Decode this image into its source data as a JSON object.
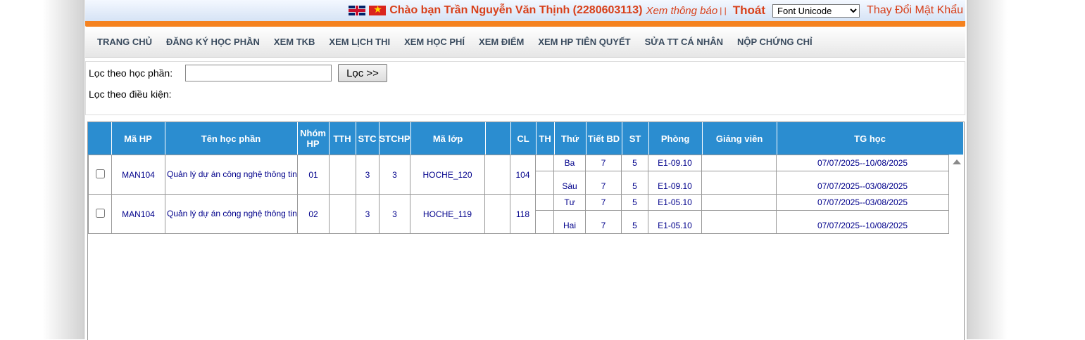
{
  "topbar": {
    "greeting": "Chào bạn Trần Nguyễn Văn Thịnh (2280603113)",
    "notice_link": "Xem thông báo",
    "separator": "| |",
    "logout": "Thoát",
    "font_select_value": "Font Unicode",
    "change_password": "Thay Đổi Mật Khẩu"
  },
  "menu": {
    "items": [
      "TRANG CHỦ",
      "ĐĂNG KÝ HỌC PHẦN",
      "XEM TKB",
      "XEM LỊCH THI",
      "XEM HỌC PHÍ",
      "XEM ĐIỂM",
      "XEM HP TIÊN QUYẾT",
      "SỬA TT CÁ NHÂN",
      "NỘP CHỨNG CHỈ"
    ]
  },
  "filter": {
    "course_label": "Lọc theo học phần:",
    "course_value": "",
    "filter_button": "Lọc >>",
    "condition_label": "Lọc theo điều kiện:"
  },
  "table": {
    "headers": [
      "",
      "Mã HP",
      "Tên học phần",
      "Nhóm HP",
      "TTH",
      "STC",
      "STCHP",
      "Mã lớp",
      "",
      "CL",
      "TH",
      "Thứ",
      "Tiết BD",
      "ST",
      "Phòng",
      "Giảng viên",
      "TG học"
    ],
    "rows": [
      {
        "code": "MAN104",
        "name": "Quản lý dự án công nghệ thông tin",
        "group": "01",
        "tth": "",
        "stc": "3",
        "stchp": "3",
        "class_code": "HOCHE_120",
        "blank": "",
        "cl": "104",
        "th": "",
        "sessions": [
          {
            "day": "Ba",
            "start": "7",
            "periods": "5",
            "room": "E1-09.10",
            "lecturer": "",
            "time": "07/07/2025--10/08/2025"
          },
          {
            "day": "Sáu",
            "start": "7",
            "periods": "5",
            "room": "E1-09.10",
            "lecturer": "",
            "time": "07/07/2025--03/08/2025"
          }
        ]
      },
      {
        "code": "MAN104",
        "name": "Quản lý dự án công nghệ thông tin",
        "group": "02",
        "tth": "",
        "stc": "3",
        "stchp": "3",
        "class_code": "HOCHE_119",
        "blank": "",
        "cl": "118",
        "th": "",
        "sessions": [
          {
            "day": "Tư",
            "start": "7",
            "periods": "5",
            "room": "E1-05.10",
            "lecturer": "",
            "time": "07/07/2025--03/08/2025"
          },
          {
            "day": "Hai",
            "start": "7",
            "periods": "5",
            "room": "E1-05.10",
            "lecturer": "",
            "time": "07/07/2025--10/08/2025"
          }
        ]
      }
    ]
  },
  "colors": {
    "accent_orange": "#f5821f",
    "header_blue": "#2b8dd0",
    "link_red": "#d8401a",
    "cell_text": "#00008b"
  }
}
